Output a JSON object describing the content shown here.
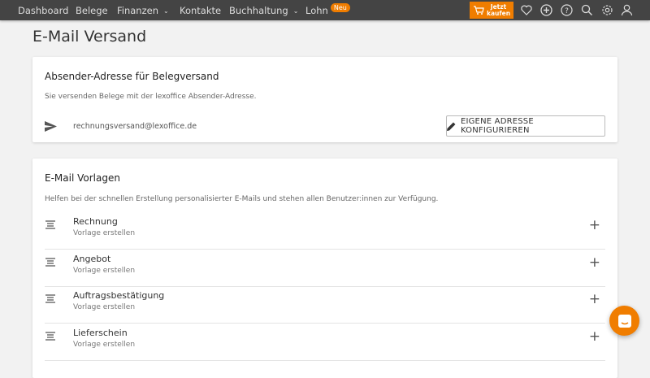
{
  "nav": {
    "items": [
      "Dashboard",
      "Belege",
      "Finanzen",
      "Kontakte",
      "Buchhaltung",
      "Lohn"
    ],
    "badge": "Neu",
    "buy_line1": "Jetzt",
    "buy_line2": "kaufen"
  },
  "page_title": "E-Mail Versand",
  "sender": {
    "title": "Absender-Adresse für Belegversand",
    "description": "Sie versenden Belege mit der lexoffice Absender-Adresse.",
    "email": "rechnungsversand@lexoffice.de",
    "button": "EIGENE ADRESSE KONFIGURIEREN"
  },
  "templates": {
    "title": "E-Mail Vorlagen",
    "description": "Helfen bei der schnellen Erstellung personalisierter E-Mails und stehen allen Benutzer:innen zur Verfügung.",
    "items": [
      {
        "name": "Rechnung",
        "action": "Vorlage erstellen"
      },
      {
        "name": "Angebot",
        "action": "Vorlage erstellen"
      },
      {
        "name": "Auftragsbestätigung",
        "action": "Vorlage erstellen"
      },
      {
        "name": "Lieferschein",
        "action": "Vorlage erstellen"
      }
    ]
  },
  "colors": {
    "accent": "#f07d00",
    "nav": "#444444"
  }
}
